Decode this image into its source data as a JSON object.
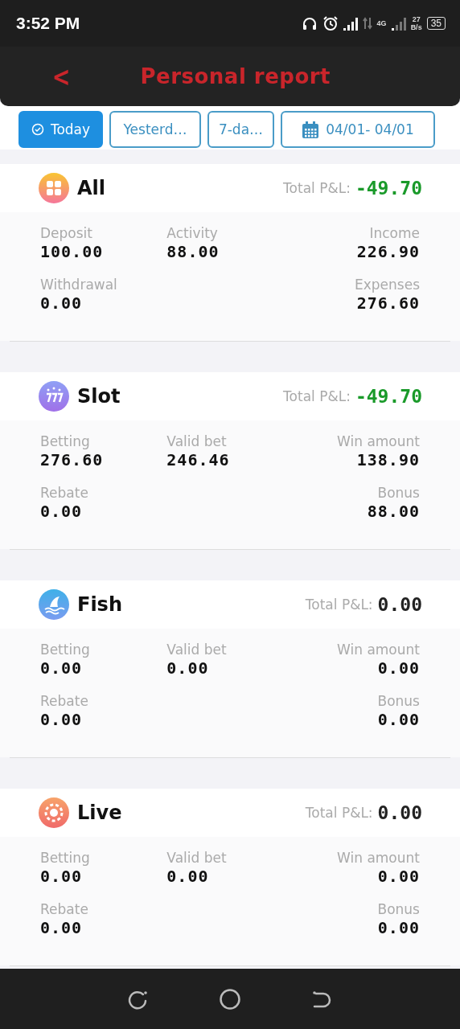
{
  "status_bar": {
    "time": "3:52 PM",
    "network": "4G",
    "speed": "27",
    "speed_unit": "B/s",
    "battery": "35"
  },
  "header": {
    "back": "<",
    "title": "Personal report"
  },
  "filters": [
    {
      "label": "Today",
      "kind": "preset",
      "selected": true
    },
    {
      "label": "Yesterd…",
      "kind": "preset",
      "selected": false
    },
    {
      "label": "7-da…",
      "kind": "preset",
      "selected": false
    },
    {
      "label": "04/01- 04/01",
      "kind": "range",
      "selected": false
    }
  ],
  "sections": [
    {
      "kind": "all",
      "title": "All",
      "pnl": {
        "label": "Total P&L:",
        "value": "-49.70",
        "color": "#1a9a2a"
      },
      "stats": [
        {
          "label": "Deposit",
          "value": "100.00"
        },
        {
          "label": "Activity",
          "value": "88.00"
        },
        {
          "label": "Income",
          "value": "226.90"
        },
        {
          "label": "Withdrawal",
          "value": "0.00"
        },
        {
          "label": "Expenses",
          "value": "276.60"
        }
      ]
    },
    {
      "kind": "slot",
      "title": "Slot",
      "pnl": {
        "label": "Total P&L:",
        "value": "-49.70",
        "color": "#1a9a2a"
      },
      "stats": [
        {
          "label": "Betting",
          "value": "276.60"
        },
        {
          "label": "Valid bet",
          "value": "246.46"
        },
        {
          "label": "Win amount",
          "value": "138.90"
        },
        {
          "label": "Rebate",
          "value": "0.00"
        },
        {
          "label": "Bonus",
          "value": "88.00"
        }
      ]
    },
    {
      "kind": "fish",
      "title": "Fish",
      "pnl": {
        "label": "Total P&L:",
        "value": "0.00",
        "color": "#222222"
      },
      "stats": [
        {
          "label": "Betting",
          "value": "0.00"
        },
        {
          "label": "Valid bet",
          "value": "0.00"
        },
        {
          "label": "Win amount",
          "value": "0.00"
        },
        {
          "label": "Rebate",
          "value": "0.00"
        },
        {
          "label": "Bonus",
          "value": "0.00"
        }
      ]
    },
    {
      "kind": "live",
      "title": "Live",
      "pnl": {
        "label": "Total P&L:",
        "value": "0.00",
        "color": "#222222"
      },
      "stats": [
        {
          "label": "Betting",
          "value": "0.00"
        },
        {
          "label": "Valid bet",
          "value": "0.00"
        },
        {
          "label": "Win amount",
          "value": "0.00"
        },
        {
          "label": "Rebate",
          "value": "0.00"
        },
        {
          "label": "Bonus",
          "value": "0.00"
        }
      ]
    }
  ]
}
